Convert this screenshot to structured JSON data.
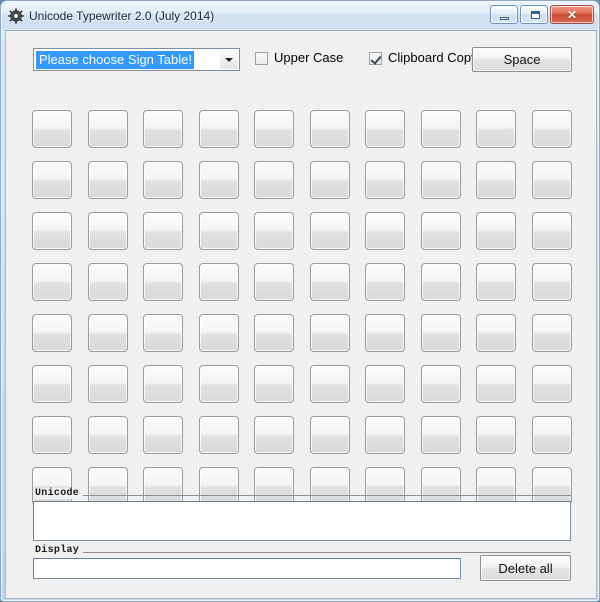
{
  "window": {
    "title": "Unicode Typewriter 2.0 (July 2014)",
    "icon": "gear-icon",
    "controls": {
      "minimize_label": "–",
      "maximize_label": "□",
      "close_label": "✕"
    },
    "colors": {
      "frame": "#cfdef0",
      "client_background": "#f0f0f0",
      "close_button": "#cf4a33",
      "selection_highlight": "#3399ff"
    }
  },
  "toolbar": {
    "sign_table": {
      "selected_value": "Please choose Sign Table!",
      "placeholder": "Please choose Sign Table!",
      "arrow_icon": "chevron-down-icon",
      "selected_text_highlighted": true
    },
    "upper_case": {
      "label": "Upper Case",
      "checked": false
    },
    "clipboard_copy": {
      "label": "Clipboard Copy",
      "checked": true
    },
    "space_button_label": "Space"
  },
  "key_grid": {
    "rows": 8,
    "columns": 10,
    "total_keys": 80,
    "keys": [
      "",
      "",
      "",
      "",
      "",
      "",
      "",
      "",
      "",
      "",
      "",
      "",
      "",
      "",
      "",
      "",
      "",
      "",
      "",
      "",
      "",
      "",
      "",
      "",
      "",
      "",
      "",
      "",
      "",
      "",
      "",
      "",
      "",
      "",
      "",
      "",
      "",
      "",
      "",
      "",
      "",
      "",
      "",
      "",
      "",
      "",
      "",
      "",
      "",
      "",
      "",
      "",
      "",
      "",
      "",
      "",
      "",
      "",
      "",
      "",
      "",
      "",
      "",
      "",
      "",
      "",
      "",
      "",
      "",
      "",
      "",
      "",
      "",
      "",
      "",
      "",
      "",
      "",
      "",
      ""
    ]
  },
  "unicode_group": {
    "label": "Unicode",
    "value": "",
    "placeholder": ""
  },
  "display_group": {
    "label": "Display",
    "value": "",
    "placeholder": "",
    "delete_all_button_label": "Delete all"
  }
}
